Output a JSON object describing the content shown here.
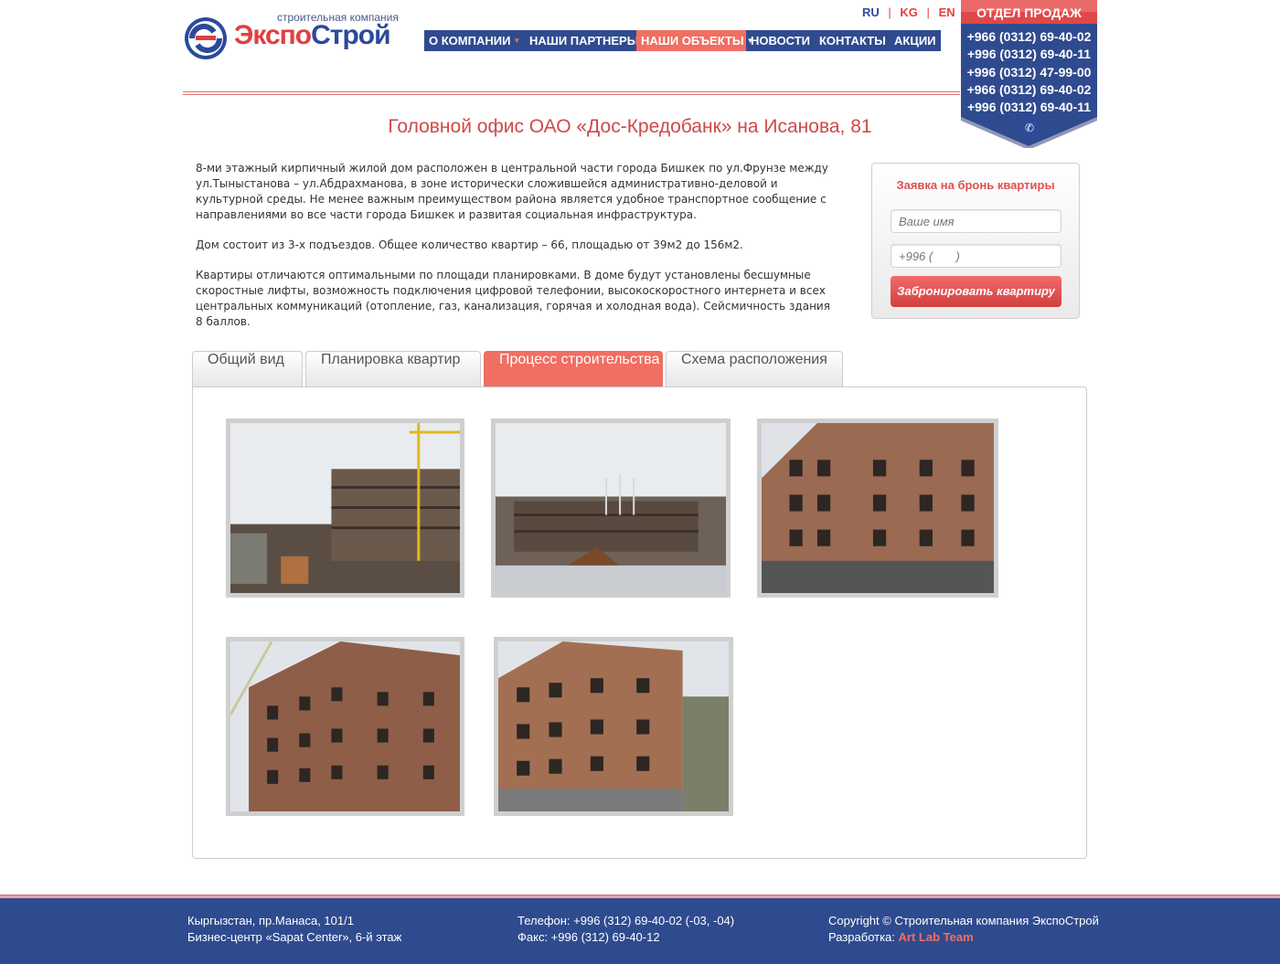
{
  "header": {
    "logo_tagline": "строительная компания",
    "logo_part1": "Экспо",
    "logo_part2": "Строй",
    "languages": [
      "RU",
      "KG",
      "EN"
    ],
    "nav": [
      {
        "label": "О КОМПАНИИ",
        "dropdown": true,
        "active": false
      },
      {
        "label": "НАШИ ПАРТНЕРЫ",
        "dropdown": false,
        "active": false
      },
      {
        "label": "НАШИ ОБЪЕКТЫ",
        "dropdown": true,
        "active": true
      },
      {
        "label": "НОВОСТИ",
        "dropdown": false,
        "active": false
      },
      {
        "label": "КОНТАКТЫ",
        "dropdown": false,
        "active": false
      },
      {
        "label": "АКЦИИ",
        "dropdown": false,
        "active": false
      }
    ]
  },
  "sales": {
    "title": "ОТДЕЛ ПРОДАЖ",
    "phones": [
      "+966 (0312) 69-40-02",
      "+996 (0312) 69-40-11",
      "+996 (0312) 47-99-00",
      "+966 (0312) 69-40-02",
      "+996 (0312) 69-40-11"
    ],
    "icon": "phone-icon"
  },
  "page": {
    "title": "Головной офис ОАО «Дос-Кредобанк» на Исанова, 81",
    "paragraphs": [
      "8-ми этажный кирпичный жилой дом расположен в центральной части города Бишкек по ул.Фрунзе между ул.Тыныстанова – ул.Абдрахманова, в зоне исторически сложившейся административно-деловой и культурной среды. Не менее важным преимуществом района является удобное транспортное сообщение с направлениями во все части города Бишкек и развитая социальная инфраструктура.",
      "Дом состоит из 3-х подъездов. Общее количество квартир – 66, площадью от 39м2 до 156м2.",
      "Квартиры отличаются оптимальными по площади планировками. В доме будут установлены бесшумные скоростные лифты, возможность подключения цифровой телефонии, высокоскоростного интернета и всех центральных коммуникаций (отопление, газ, канализация, горячая и холодная вода). Сейсмичность здания 8 баллов."
    ]
  },
  "booking": {
    "title": "Заявка на бронь квартиры",
    "name_placeholder": "Ваше имя",
    "phone_placeholder": "+996 (       )",
    "submit": "Забронировать квартиру"
  },
  "tabs": [
    {
      "label": "Общий вид",
      "active": false
    },
    {
      "label": "Планировка квартир",
      "active": false
    },
    {
      "label": "Процесс строительства",
      "active": true
    },
    {
      "label": "Схема расположения",
      "active": false
    }
  ],
  "footer": {
    "address_line1": "Кыргызстан, пр.Манаса, 101/1",
    "address_line2": "Бизнес-центр «Sapat Center», 6-й этаж",
    "phone": "Телефон: +996 (312) 69-40-02 (-03, -04)",
    "fax": "Факс: +996 (312) 69-40-12",
    "copyright": "Copyright © Строительная компания ЭкспоСтрой",
    "dev_label": "Разработка:",
    "dev_name": "Art Lab Team"
  },
  "colors": {
    "brand_blue": "#2f4b8f",
    "accent_red": "#f06e62",
    "title_red": "#d04848"
  }
}
